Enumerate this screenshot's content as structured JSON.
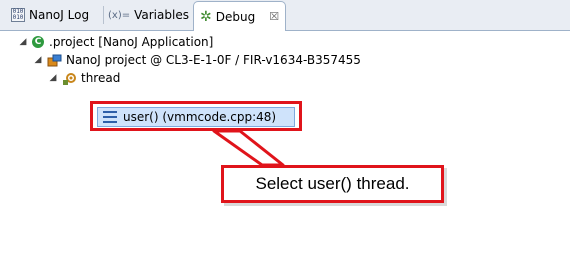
{
  "tabs": [
    {
      "label": "NanoJ Log",
      "icon": "log-icon"
    },
    {
      "label": "Variables",
      "icon_text": "(x)=",
      "icon": "variables-icon"
    },
    {
      "label": "Debug",
      "icon": "debug-icon",
      "active": true,
      "close": "☒"
    }
  ],
  "tree": {
    "project": {
      "label": ".project [NanoJ Application]",
      "icon_text": "C"
    },
    "target": {
      "label": "NanoJ project @ CL3-E-1-0F / FIR-v1634-B357455"
    },
    "thread": {
      "label": "thread"
    },
    "frame": {
      "label": "user() (vmmcode.cpp:48)"
    }
  },
  "callout": {
    "text": "Select user() thread."
  },
  "colors": {
    "highlight": "#e0141b",
    "selection": "#cfe3fb",
    "tabbar": "#e9edf3"
  }
}
